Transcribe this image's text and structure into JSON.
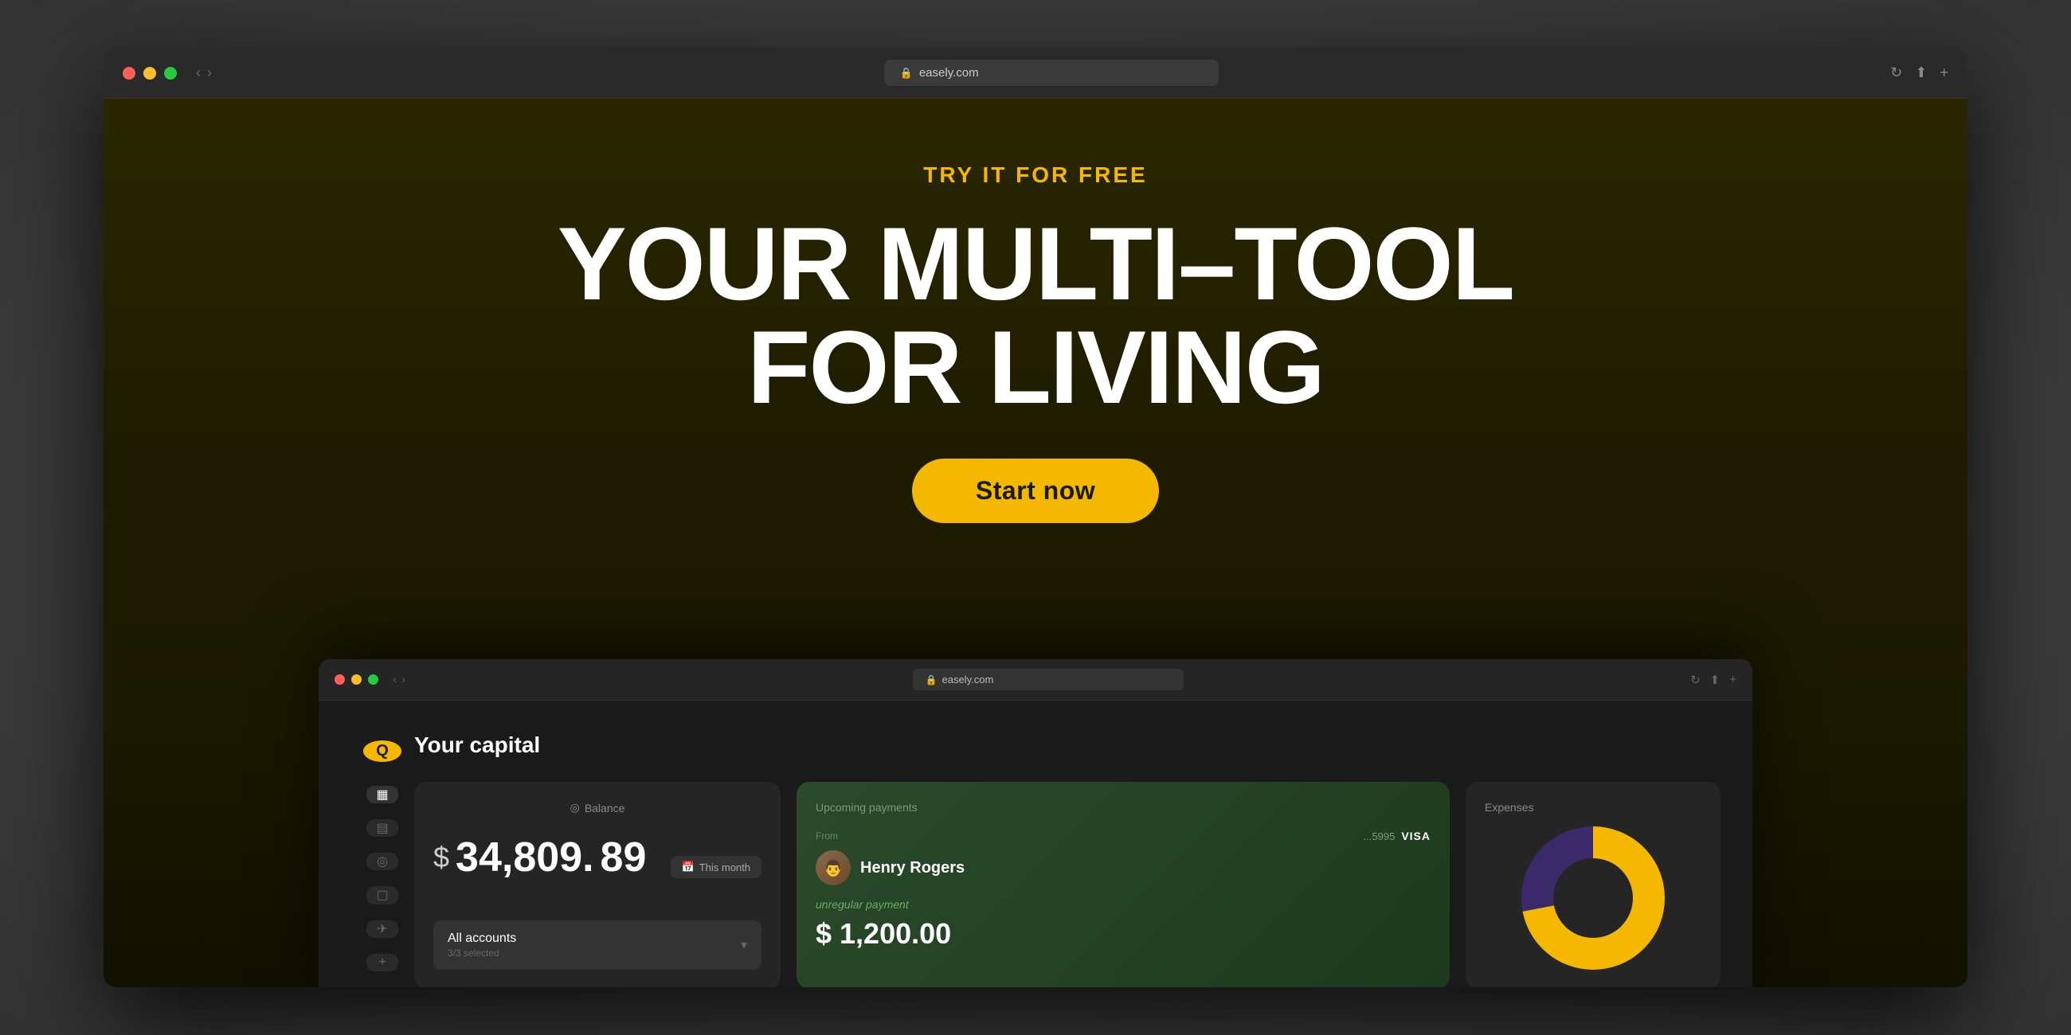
{
  "desktop": {
    "bg_color": "#404040"
  },
  "outer_browser": {
    "url": "easely.com",
    "traffic_lights": {
      "red": "#ff5f56",
      "yellow": "#ffbd2e",
      "green": "#27c93f"
    },
    "nav_back": "‹",
    "nav_forward": "›",
    "reload_icon": "↻",
    "share_icon": "⬆",
    "new_tab_icon": "+"
  },
  "hero": {
    "tagline": "TRY IT FOR FREE",
    "title_line1": "YOUR MULTI–TOOL",
    "title_line2": "FOR LIVING",
    "cta_button": "Start now"
  },
  "inner_browser": {
    "url": "easely.com"
  },
  "dashboard": {
    "title": "Your capital",
    "balance_card": {
      "header": "Balance",
      "currency_symbol": "$",
      "amount": "34,809.",
      "decimal": "89",
      "this_month_label": "This month",
      "accounts_label": "All accounts",
      "accounts_sub": "3/3 selected"
    },
    "upcoming_card": {
      "header": "Upcoming payments",
      "from_label": "From",
      "card_last4": "...5995",
      "card_brand": "VISA",
      "person_name": "Henry Rogers",
      "payment_type": "unregular payment",
      "payment_amount": "$ 1,200.00"
    },
    "expenses_card": {
      "header": "Expenses",
      "chart_yellow_pct": 72,
      "chart_purple_pct": 28
    },
    "sidebar": {
      "logo_letter": "Q",
      "icons": [
        "▦",
        "▤",
        "◎",
        "▢",
        "✈",
        "+"
      ]
    }
  }
}
